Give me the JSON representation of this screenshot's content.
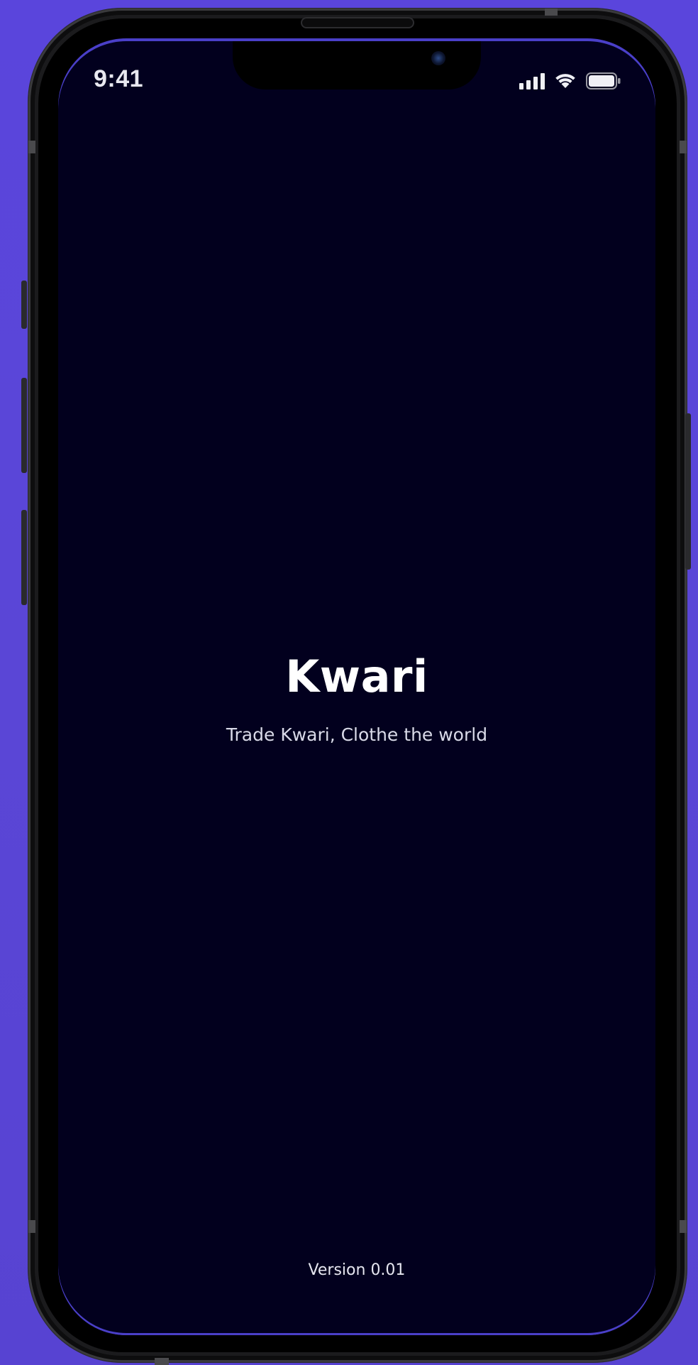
{
  "status_bar": {
    "time": "9:41",
    "signal_icon": "cellular-signal-icon",
    "wifi_icon": "wifi-icon",
    "battery_icon": "battery-icon"
  },
  "splash": {
    "title": "Kwari",
    "tagline": "Trade Kwari, Clothe the world",
    "version": "Version 0.01"
  },
  "colors": {
    "background": "#5A45DC",
    "screen": "#02001E",
    "title_text": "#FFFFFF",
    "tagline_text": "#D9DAE8"
  }
}
